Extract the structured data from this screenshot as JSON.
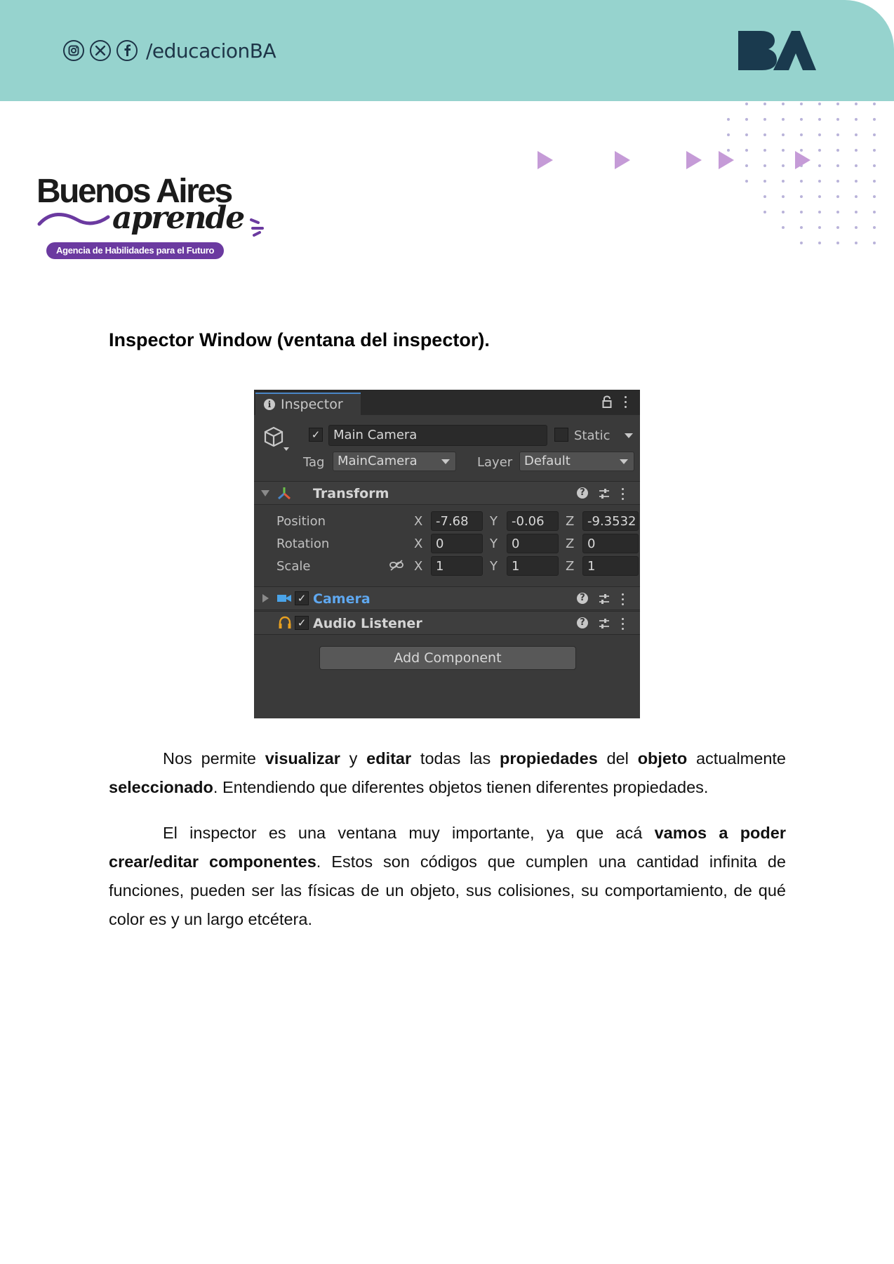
{
  "header": {
    "social_handle": "/educacionBA",
    "social_icons": [
      "instagram-icon",
      "x-icon",
      "facebook-icon"
    ],
    "logo_text": "BA",
    "band_color": "#96d3ce"
  },
  "brand": {
    "title": "Buenos Aires",
    "subtitle": "aprende",
    "tagline": "Agencia de Habilidades para el Futuro",
    "accent": "#6b3aa0"
  },
  "section": {
    "title": "Inspector Window (ventana del inspector)."
  },
  "inspector": {
    "tab_label": "Inspector",
    "object_name": "Main Camera",
    "static_label": "Static",
    "tag_label": "Tag",
    "tag_value": "MainCamera",
    "layer_label": "Layer",
    "layer_value": "Default",
    "transform": {
      "title": "Transform",
      "rows": [
        {
          "label": "Position",
          "x": "-7.68",
          "y": "-0.06",
          "z": "-9.3532"
        },
        {
          "label": "Rotation",
          "x": "0",
          "y": "0",
          "z": "0"
        },
        {
          "label": "Scale",
          "x": "1",
          "y": "1",
          "z": "1"
        }
      ],
      "axis_x": "X",
      "axis_y": "Y",
      "axis_z": "Z"
    },
    "camera_title": "Camera",
    "audio_title": "Audio Listener",
    "add_component": "Add Component"
  },
  "paragraphs": {
    "p1": [
      {
        "t": "Nos permite ",
        "b": false
      },
      {
        "t": "visualizar",
        "b": true
      },
      {
        "t": " y ",
        "b": false
      },
      {
        "t": "editar",
        "b": true
      },
      {
        "t": " todas las ",
        "b": false
      },
      {
        "t": "propiedades",
        "b": true
      },
      {
        "t": " del ",
        "b": false
      },
      {
        "t": "objeto",
        "b": true
      },
      {
        "t": " actualmente ",
        "b": false
      },
      {
        "t": "seleccionado",
        "b": true
      },
      {
        "t": ". Entendiendo que diferentes objetos tienen diferentes propiedades.",
        "b": false
      }
    ],
    "p2": [
      {
        "t": "El inspector es una ventana muy importante, ya que acá ",
        "b": false
      },
      {
        "t": "vamos a poder crear/editar componentes",
        "b": true
      },
      {
        "t": ". Estos son códigos que cumplen una cantidad infinita de funciones, pueden ser las físicas de un objeto, sus colisiones, su comportamiento, de qué color es y un largo etcétera.",
        "b": false
      }
    ]
  }
}
